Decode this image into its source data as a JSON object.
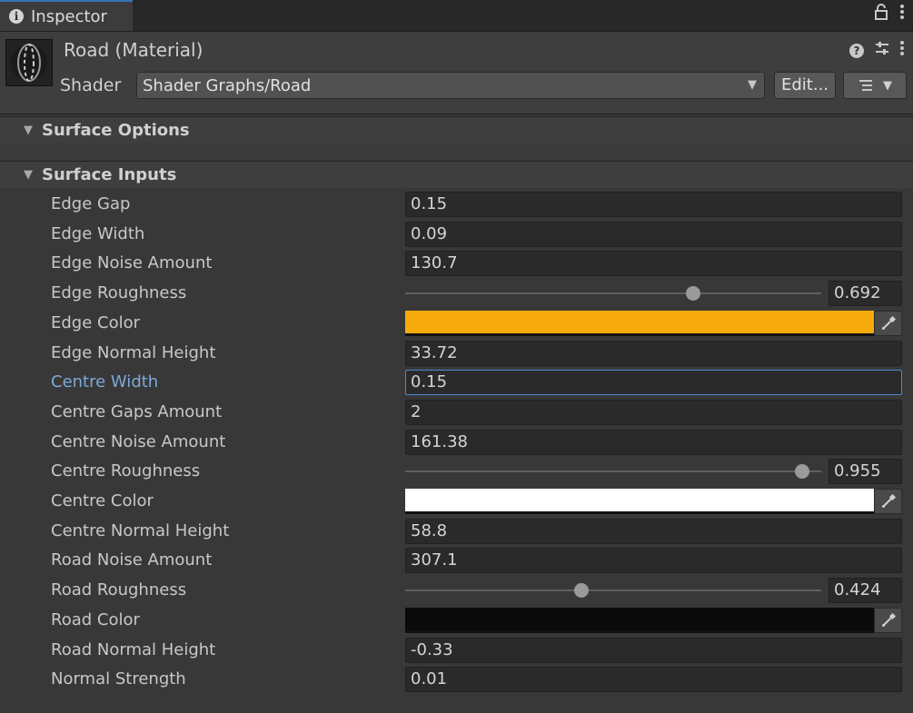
{
  "tab": {
    "label": "Inspector",
    "icon": "info-icon"
  },
  "header": {
    "title": "Road (Material)",
    "shader_label": "Shader",
    "shader_value": "Shader Graphs/Road",
    "edit_label": "Edit..."
  },
  "sections": {
    "surface_options": "Surface Options",
    "surface_inputs": "Surface Inputs"
  },
  "props": [
    {
      "label": "Edge Gap",
      "type": "float",
      "value": "0.15"
    },
    {
      "label": "Edge Width",
      "type": "float",
      "value": "0.09"
    },
    {
      "label": "Edge Noise Amount",
      "type": "float",
      "value": "130.7"
    },
    {
      "label": "Edge Roughness",
      "type": "slider",
      "value": "0.692",
      "fraction": 0.692
    },
    {
      "label": "Edge Color",
      "type": "color",
      "color": "#f7aa0c"
    },
    {
      "label": "Edge Normal Height",
      "type": "float",
      "value": "33.72"
    },
    {
      "label": "Centre Width",
      "type": "float",
      "value": "0.15",
      "focused": true
    },
    {
      "label": "Centre Gaps Amount",
      "type": "float",
      "value": "2"
    },
    {
      "label": "Centre Noise Amount",
      "type": "float",
      "value": "161.38"
    },
    {
      "label": "Centre Roughness",
      "type": "slider",
      "value": "0.955",
      "fraction": 0.955
    },
    {
      "label": "Centre Color",
      "type": "color",
      "color": "#ffffff"
    },
    {
      "label": "Centre Normal Height",
      "type": "float",
      "value": "58.8"
    },
    {
      "label": "Road Noise Amount",
      "type": "float",
      "value": "307.1"
    },
    {
      "label": "Road Roughness",
      "type": "slider",
      "value": "0.424",
      "fraction": 0.424
    },
    {
      "label": "Road Color",
      "type": "color",
      "color": "#0a0a0a"
    },
    {
      "label": "Road Normal Height",
      "type": "float",
      "value": "-0.33"
    },
    {
      "label": "Normal Strength",
      "type": "float",
      "value": "0.01"
    }
  ]
}
